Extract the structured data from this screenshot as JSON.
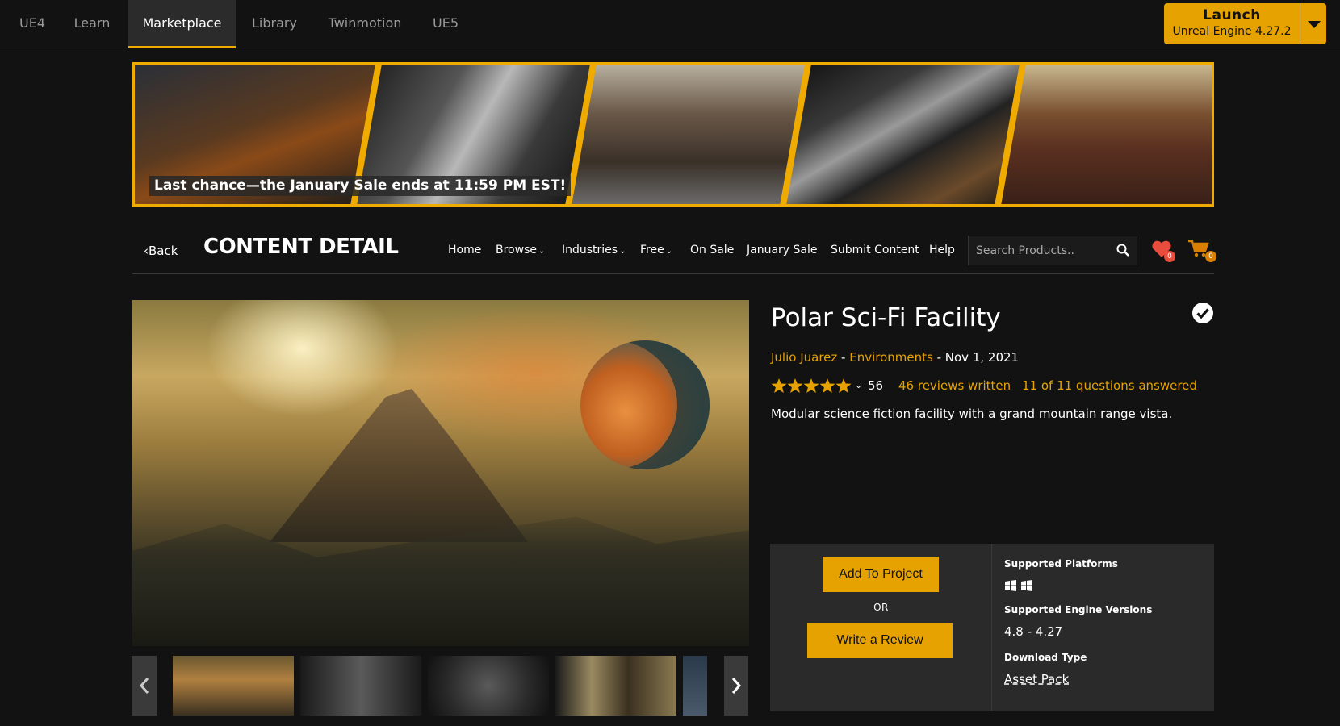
{
  "top_tabs": [
    {
      "label": "UE4",
      "active": false
    },
    {
      "label": "Learn",
      "active": false
    },
    {
      "label": "Marketplace",
      "active": true
    },
    {
      "label": "Library",
      "active": false
    },
    {
      "label": "Twinmotion",
      "active": false
    },
    {
      "label": "UE5",
      "active": false
    }
  ],
  "launch": {
    "title": "Launch",
    "subtitle": "Unreal Engine 4.27.2"
  },
  "banner": {
    "text": "Last chance—the January Sale ends at 11:59 PM EST!"
  },
  "subnav": {
    "back_label": "Back",
    "page_title": "CONTENT DETAIL",
    "links": {
      "home": "Home",
      "browse": "Browse",
      "industries": "Industries",
      "free": "Free",
      "on_sale": "On Sale",
      "january_sale": "January Sale",
      "submit_content": "Submit Content",
      "help": "Help"
    },
    "search_placeholder": "Search Products..",
    "wishlist_count": "0",
    "cart_count": "0"
  },
  "product": {
    "title": "Polar Sci-Fi Facility",
    "author": "Julio Juarez",
    "separator1": " - ",
    "category": "Environments",
    "separator2": " - ",
    "date": "Nov 1, 2021",
    "stars": 5,
    "rating_count": "56",
    "reviews_link": "46 reviews written",
    "questions_link": "11 of 11 questions answered",
    "description": "Modular science fiction facility with a grand mountain range vista."
  },
  "actions": {
    "add_to_project": "Add To Project",
    "or_label": "OR",
    "write_review": "Write a Review"
  },
  "specs": {
    "platforms_label": "Supported Platforms",
    "engine_label": "Supported Engine Versions",
    "engine_value": "4.8 - 4.27",
    "download_label": "Download Type",
    "download_value": "Asset Pack"
  },
  "colors": {
    "accent": "#e6a200",
    "background": "#121212",
    "panel": "#2a2a2a"
  }
}
